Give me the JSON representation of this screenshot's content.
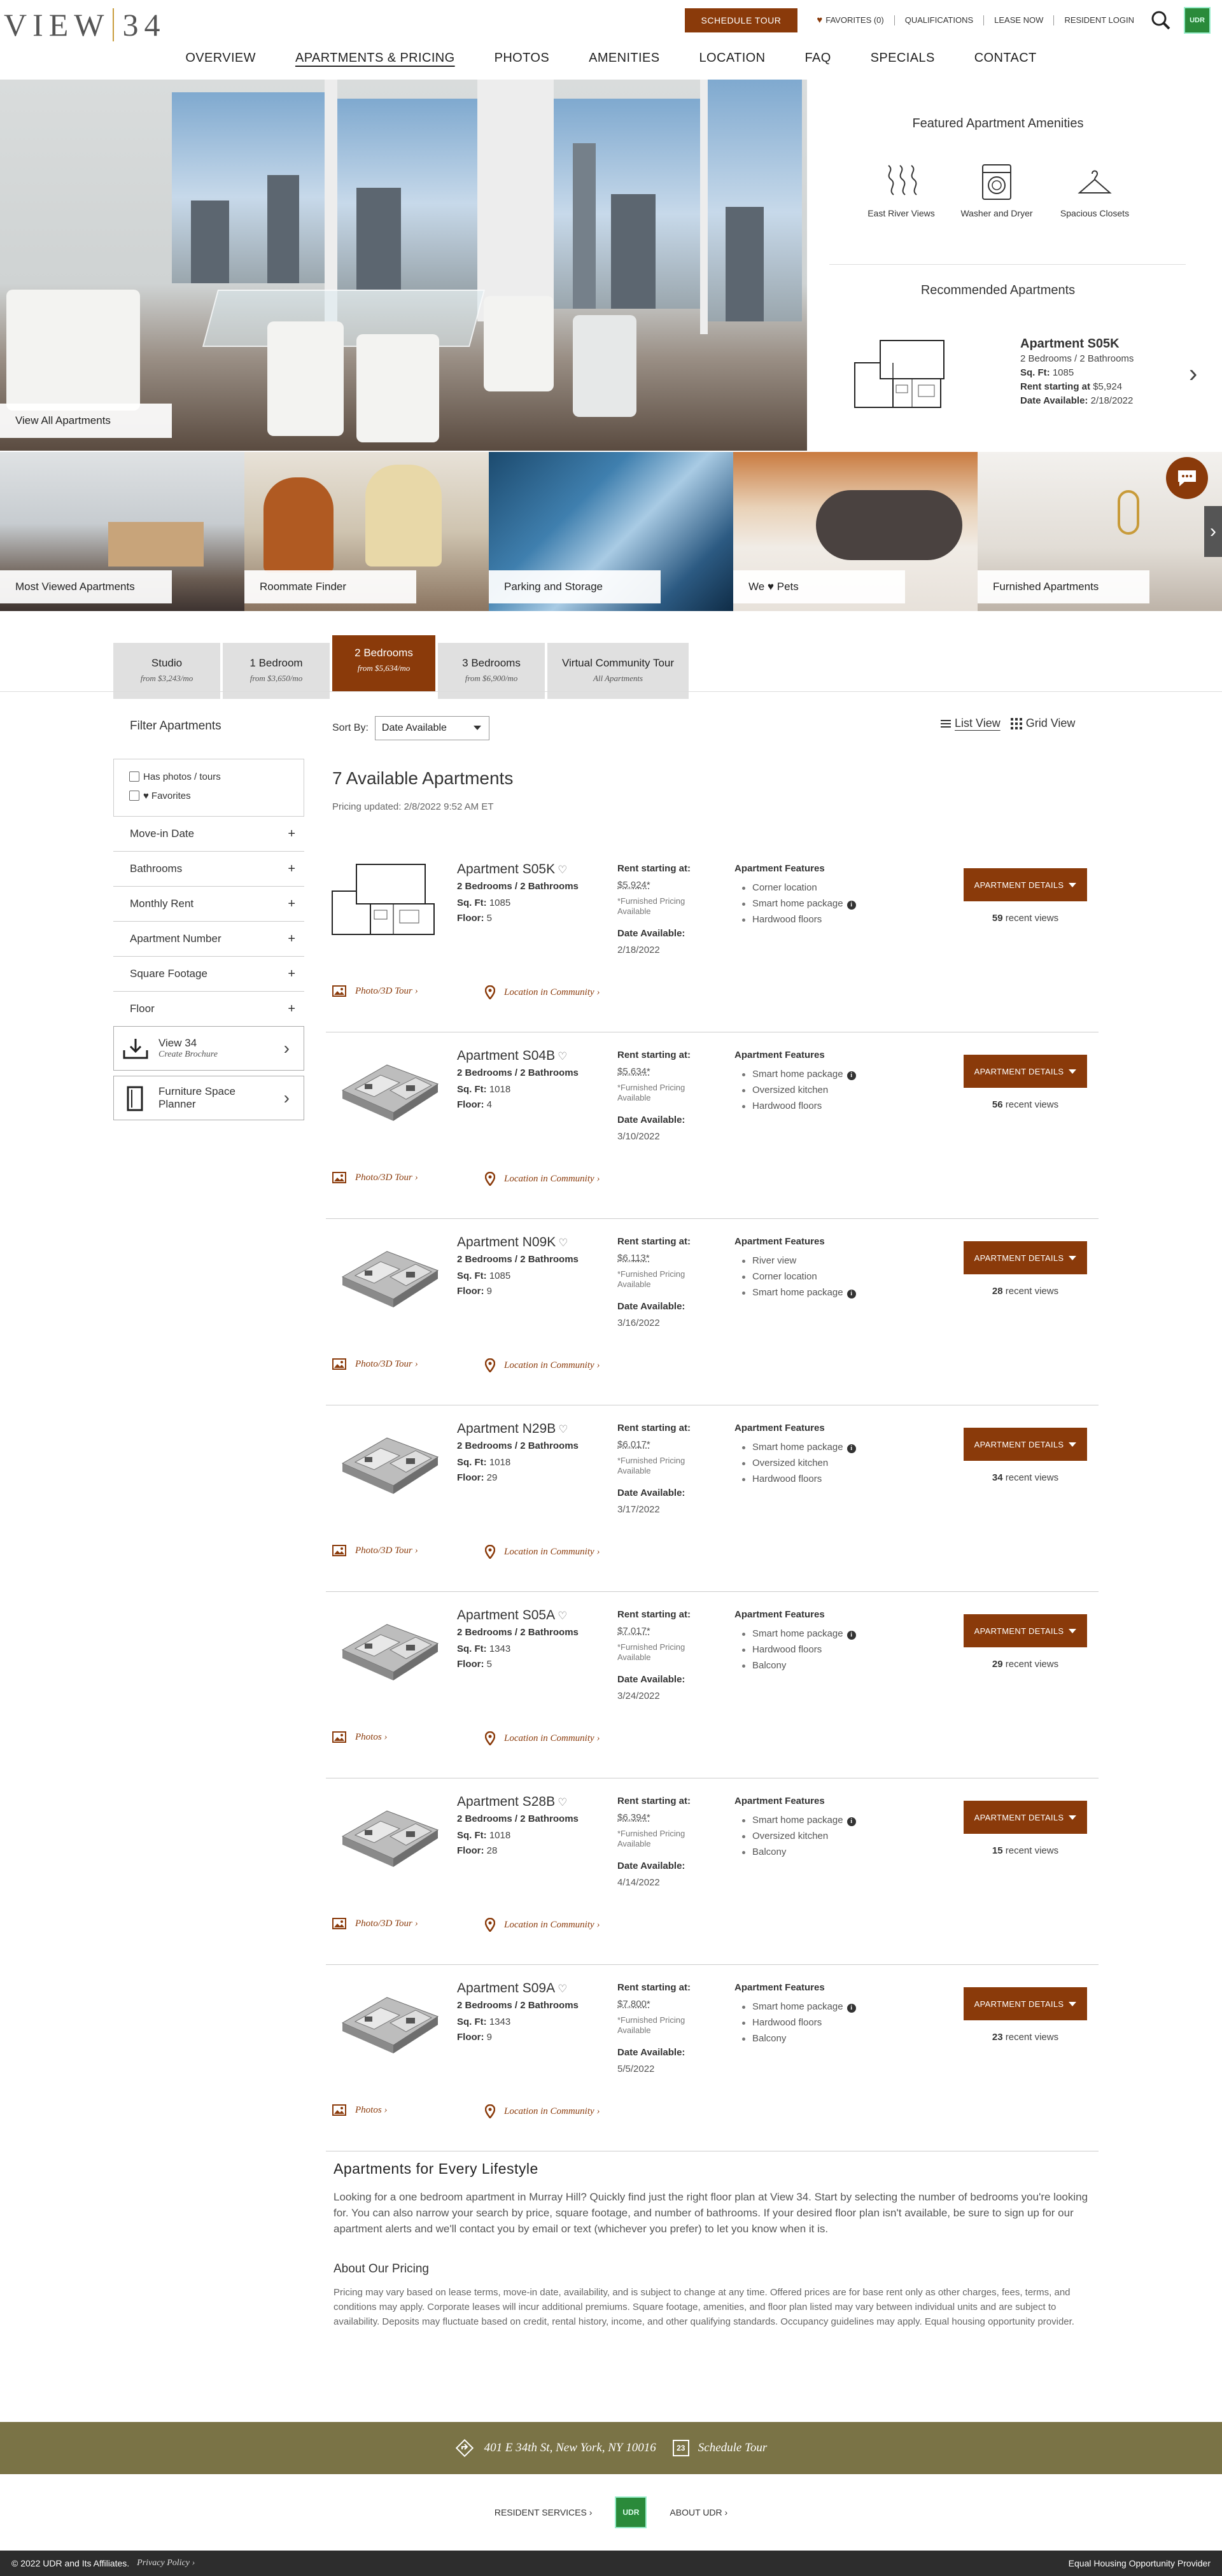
{
  "header": {
    "logo": "VIEW 34",
    "schedule_tour": "SCHEDULE TOUR",
    "favorites": "FAVORITES (0)",
    "qualifications": "QUALIFICATIONS",
    "lease_now": "LEASE NOW",
    "resident_login": "RESIDENT LOGIN",
    "udr_logo": "UDR"
  },
  "nav": [
    "OVERVIEW",
    "APARTMENTS & PRICING",
    "PHOTOS",
    "AMENITIES",
    "LOCATION",
    "FAQ",
    "SPECIALS",
    "CONTACT"
  ],
  "hero": {
    "view_all": "View All Apartments"
  },
  "featured": {
    "title": "Featured Apartment Amenities",
    "items": [
      {
        "label": "East River Views",
        "icon": "river-view-icon"
      },
      {
        "label": "Washer and Dryer",
        "icon": "washer-icon"
      },
      {
        "label": "Spacious Closets",
        "icon": "hanger-icon"
      }
    ]
  },
  "recommended": {
    "title": "Recommended Apartments",
    "name": "Apartment S05K",
    "beds": "2 Bedrooms / 2 Bathrooms",
    "sqft_label": "Sq. Ft:",
    "sqft": "1085",
    "rent_label": "Rent starting at",
    "rent": "$5,924",
    "date_label": "Date Available:",
    "date": "2/18/2022"
  },
  "tiles": [
    "Most Viewed Apartments",
    "Roommate Finder",
    "Parking and Storage",
    "We ♥ Pets",
    "Furnished Apartments"
  ],
  "bed_tabs": [
    {
      "title": "Studio",
      "sub": "from $3,243/mo"
    },
    {
      "title": "1 Bedroom",
      "sub": "from $3,650/mo"
    },
    {
      "title": "2 Bedrooms",
      "sub": "from $5,634/mo"
    },
    {
      "title": "3 Bedrooms",
      "sub": "from $6,900/mo"
    },
    {
      "title": "Virtual Community Tour",
      "sub": "All Apartments"
    }
  ],
  "filters": {
    "title": "Filter Apartments",
    "has_photos": "Has photos / tours",
    "favorites": "Favorites",
    "accordions": [
      "Move-in Date",
      "Bathrooms",
      "Monthly Rent",
      "Apartment Number",
      "Square Footage",
      "Floor"
    ],
    "brochure_title": "View 34",
    "brochure_sub": "Create Brochure",
    "planner": "Furniture Space Planner"
  },
  "list": {
    "sort_label": "Sort By:",
    "sort_value": "Date Available",
    "list_view": "List View",
    "grid_view": "Grid View",
    "count_title": "7 Available Apartments",
    "pricing_updated": "Pricing updated: 2/8/2022 9:52 AM ET",
    "labels": {
      "sqft": "Sq. Ft:",
      "floor": "Floor:",
      "rent": "Rent starting at:",
      "furnished": "*Furnished Pricing Available",
      "date": "Date Available:",
      "features": "Apartment Features",
      "details": "APARTMENT DETAILS",
      "recent": "recent views",
      "location": "Location in Community ›"
    },
    "apartments": [
      {
        "name": "Apartment S05K",
        "beds": "2 Bedrooms / 2 Bathrooms",
        "sqft": "1085",
        "floor": "5",
        "price": "$5,924*",
        "date": "2/18/2022",
        "features": [
          "Corner location",
          "Smart home package",
          "Hardwood floors"
        ],
        "info": [
          false,
          true,
          false
        ],
        "views": "59",
        "photos": "Photo/3D Tour ›"
      },
      {
        "name": "Apartment S04B",
        "beds": "2 Bedrooms / 2 Bathrooms",
        "sqft": "1018",
        "floor": "4",
        "price": "$5,634*",
        "date": "3/10/2022",
        "features": [
          "Smart home package",
          "Oversized kitchen",
          "Hardwood floors"
        ],
        "info": [
          true,
          false,
          false
        ],
        "views": "56",
        "photos": "Photo/3D Tour ›"
      },
      {
        "name": "Apartment N09K",
        "beds": "2 Bedrooms / 2 Bathrooms",
        "sqft": "1085",
        "floor": "9",
        "price": "$6,113*",
        "date": "3/16/2022",
        "features": [
          "River view",
          "Corner location",
          "Smart home package"
        ],
        "info": [
          false,
          false,
          true
        ],
        "views": "28",
        "photos": "Photo/3D Tour ›"
      },
      {
        "name": "Apartment N29B",
        "beds": "2 Bedrooms / 2 Bathrooms",
        "sqft": "1018",
        "floor": "29",
        "price": "$6,017*",
        "date": "3/17/2022",
        "features": [
          "Smart home package",
          "Oversized kitchen",
          "Hardwood floors"
        ],
        "info": [
          true,
          false,
          false
        ],
        "views": "34",
        "photos": "Photo/3D Tour ›"
      },
      {
        "name": "Apartment S05A",
        "beds": "2 Bedrooms / 2 Bathrooms",
        "sqft": "1343",
        "floor": "5",
        "price": "$7,017*",
        "date": "3/24/2022",
        "features": [
          "Smart home package",
          "Hardwood floors",
          "Balcony"
        ],
        "info": [
          true,
          false,
          false
        ],
        "views": "29",
        "photos": "Photos ›"
      },
      {
        "name": "Apartment S28B",
        "beds": "2 Bedrooms / 2 Bathrooms",
        "sqft": "1018",
        "floor": "28",
        "price": "$6,394*",
        "date": "4/14/2022",
        "features": [
          "Smart home package",
          "Oversized kitchen",
          "Balcony"
        ],
        "info": [
          true,
          false,
          false
        ],
        "views": "15",
        "photos": "Photo/3D Tour ›"
      },
      {
        "name": "Apartment S09A",
        "beds": "2 Bedrooms / 2 Bathrooms",
        "sqft": "1343",
        "floor": "9",
        "price": "$7,800*",
        "date": "5/5/2022",
        "features": [
          "Smart home package",
          "Hardwood floors",
          "Balcony"
        ],
        "info": [
          true,
          false,
          false
        ],
        "views": "23",
        "photos": "Photos ›"
      }
    ]
  },
  "about": {
    "title": "Apartments for Every Lifestyle",
    "body": "Looking for a one bedroom apartment in Murray Hill? Quickly find just the right floor plan at View 34. Start by selecting the number of bedrooms you're looking for. You can also narrow your search by price, square footage, and number of bathrooms. If your desired floor plan isn't available, be sure to sign up for our apartment alerts and we'll contact you by email or text (whichever you prefer) to let you know when it is.",
    "pricing_title": "About Our Pricing",
    "pricing_body": "Pricing may vary based on lease terms, move-in date, availability, and is subject to change at any time. Offered prices are for base rent only as other charges, fees, terms, and conditions may apply. Corporate leases will incur additional premiums. Square footage, amenities, and floor plan listed may vary between individual units and are subject to availability. Deposits may fluctuate based on credit, rental history, income, and other qualifying standards. Occupancy guidelines may apply. Equal housing opportunity provider."
  },
  "footer": {
    "address": "401 E 34th St, New York, NY 10016",
    "schedule": "Schedule Tour",
    "calendar_day": "23",
    "resident_services": "RESIDENT SERVICES ›",
    "about_udr": "ABOUT UDR ›",
    "udr": "UDR",
    "copyright": "© 2022 UDR and Its Affiliates.",
    "privacy": "Privacy Policy ›",
    "eho": "Equal Housing Opportunity Provider"
  },
  "colors": {
    "accent": "#8a3a0a",
    "footer_band": "#7a7346",
    "brand_green": "#2a8a3a"
  }
}
